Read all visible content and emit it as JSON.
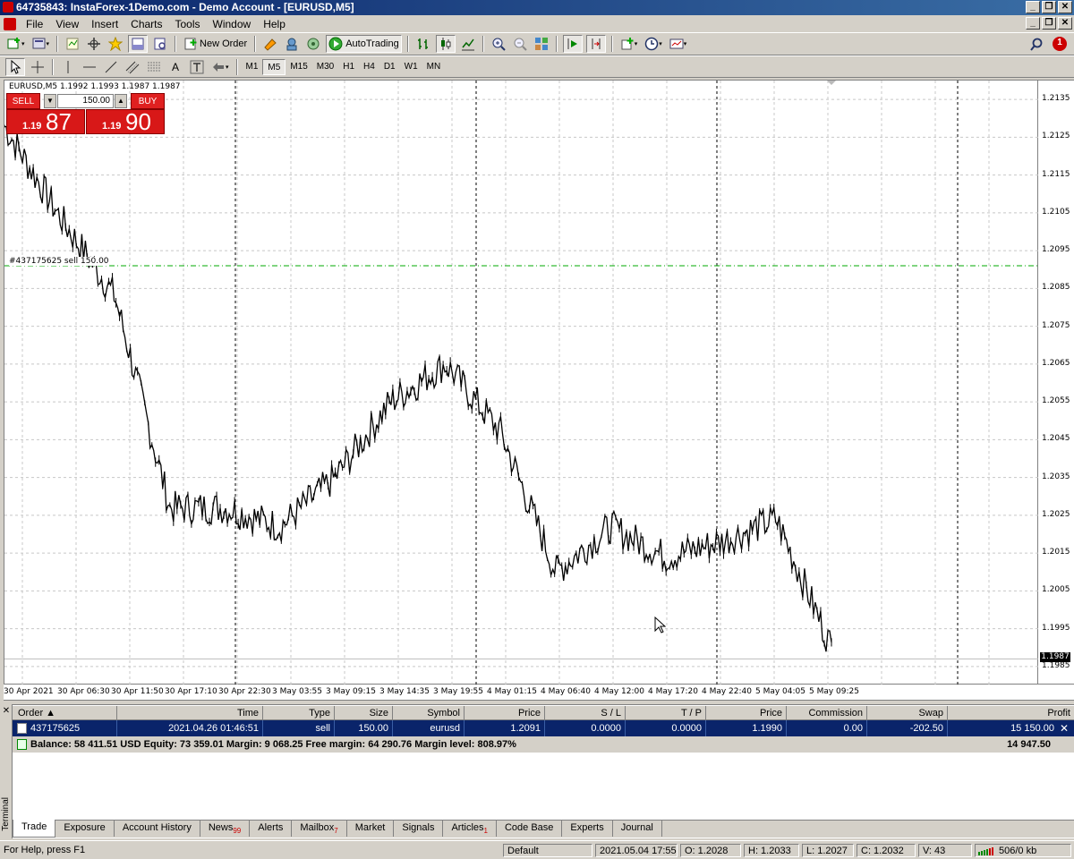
{
  "window": {
    "title": "64735843: InstaForex-1Demo.com - Demo Account - [EURUSD,M5]"
  },
  "menu": [
    "File",
    "View",
    "Insert",
    "Charts",
    "Tools",
    "Window",
    "Help"
  ],
  "toolbar1": {
    "new_order": "New Order",
    "autotrading": "AutoTrading",
    "alerts_badge": "1"
  },
  "timeframes": [
    "M1",
    "M5",
    "M15",
    "M30",
    "H1",
    "H4",
    "D1",
    "W1",
    "MN"
  ],
  "active_timeframe": "M5",
  "chart": {
    "info": "EURUSD,M5  1.1992 1.1993 1.1987 1.1987",
    "order_line_label": "#437175625 sell 150.00",
    "current_price": "1.1987",
    "y_ticks": [
      "1.2135",
      "1.2125",
      "1.2115",
      "1.2105",
      "1.2095",
      "1.2085",
      "1.2075",
      "1.2065",
      "1.2055",
      "1.2045",
      "1.2035",
      "1.2025",
      "1.2015",
      "1.2005",
      "1.1995",
      "1.1985"
    ],
    "x_ticks": [
      "30 Apr 2021",
      "30 Apr 06:30",
      "30 Apr 11:50",
      "30 Apr 17:10",
      "30 Apr 22:30",
      "3 May 03:55",
      "3 May 09:15",
      "3 May 14:35",
      "3 May 19:55",
      "4 May 01:15",
      "4 May 06:40",
      "4 May 12:00",
      "4 May 17:20",
      "4 May 22:40",
      "5 May 04:05",
      "5 May 09:25"
    ]
  },
  "chart_data": {
    "type": "line",
    "symbol": "EURUSD",
    "timeframe": "M5",
    "x": [
      "30 Apr 2021",
      "30 Apr 06:30",
      "30 Apr 11:50",
      "30 Apr 17:10",
      "30 Apr 22:30",
      "3 May 03:55",
      "3 May 09:15",
      "3 May 14:35",
      "3 May 19:55",
      "4 May 01:15",
      "4 May 06:40",
      "4 May 12:00",
      "4 May 17:20",
      "4 May 22:40",
      "5 May 04:05",
      "5 May 09:25"
    ],
    "series": [
      {
        "values": [
          1.2128,
          1.2104,
          1.2083,
          1.2027,
          1.2027,
          1.2022,
          1.2035,
          1.2055,
          1.2065,
          1.2047,
          1.201,
          1.2022,
          1.2014,
          1.2018,
          1.2024,
          1.199
        ]
      }
    ],
    "ylim": [
      1.198,
      1.214
    ],
    "hlines": [
      {
        "label": "#437175625 sell 150.00",
        "value": 1.2091
      }
    ],
    "current_price": 1.1987
  },
  "oneclick": {
    "sell_label": "SELL",
    "buy_label": "BUY",
    "lot": "150.00",
    "sell_prefix": "1.19",
    "sell_big": "87",
    "buy_prefix": "1.19",
    "buy_big": "90"
  },
  "terminal": {
    "side_label": "Terminal",
    "columns": [
      "Order",
      "Time",
      "Type",
      "Size",
      "Symbol",
      "Price",
      "S / L",
      "T / P",
      "Price",
      "Commission",
      "Swap",
      "Profit"
    ],
    "row": [
      "437175625",
      "2021.04.26 01:46:51",
      "sell",
      "150.00",
      "eurusd",
      "1.2091",
      "0.0000",
      "0.0000",
      "1.1990",
      "0.00",
      "-202.50",
      "15 150.00"
    ],
    "balance_line": "Balance: 58 411.51 USD  Equity: 73 359.01  Margin: 9 068.25  Free margin: 64 290.76  Margin level: 808.97%",
    "total": "14 947.50",
    "tabs": [
      {
        "label": "Trade",
        "badge": ""
      },
      {
        "label": "Exposure",
        "badge": ""
      },
      {
        "label": "Account History",
        "badge": ""
      },
      {
        "label": "News",
        "badge": "99"
      },
      {
        "label": "Alerts",
        "badge": ""
      },
      {
        "label": "Mailbox",
        "badge": "7"
      },
      {
        "label": "Market",
        "badge": ""
      },
      {
        "label": "Signals",
        "badge": ""
      },
      {
        "label": "Articles",
        "badge": "1"
      },
      {
        "label": "Code Base",
        "badge": ""
      },
      {
        "label": "Experts",
        "badge": ""
      },
      {
        "label": "Journal",
        "badge": ""
      }
    ]
  },
  "status": {
    "help": "For Help, press F1",
    "profile": "Default",
    "datetime": "2021.05.04 17:55",
    "open": "O: 1.2028",
    "high": "H: 1.2033",
    "low": "L: 1.2027",
    "close": "C: 1.2032",
    "volume": "V: 43",
    "traffic": "506/0 kb"
  }
}
